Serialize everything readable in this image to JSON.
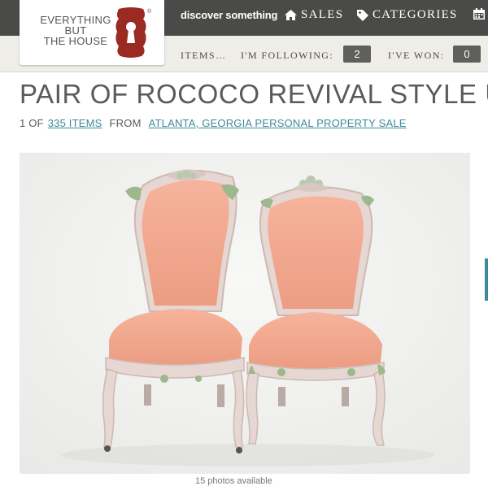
{
  "header": {
    "logo_lines": [
      "EVERYTHING",
      "BUT",
      "THE HOUSE"
    ],
    "logo_reg": "®",
    "discover": "discover something",
    "nav": {
      "sales": "SALES",
      "categories": "CATEGORIES"
    }
  },
  "subnav": {
    "items": "ITEMS…",
    "following_label": "I'M FOLLOWING:",
    "following_count": "2",
    "won_label": "I'VE WON:",
    "won_count": "0"
  },
  "item": {
    "title": "PAIR OF ROCOCO REVIVAL STYLE U",
    "position": "1 OF",
    "count_link": "335 ITEMS",
    "from": "FROM",
    "sale_link": "ATLANTA, GEORGIA PERSONAL PROPERTY SALE",
    "photos_caption": "15 photos available"
  },
  "colors": {
    "topbar": "#4a4a48",
    "subbar": "#efede7",
    "accent_link": "#3d8a9a",
    "logo_red": "#9b2a22",
    "upholstery": "#f2a98f",
    "frame": "#e6d7d2",
    "carving_green": "#9db88c"
  },
  "icons": {
    "sales": "home-icon",
    "categories": "tag-icon",
    "calendar": "calendar-icon",
    "logo": "keyhole-shield-icon"
  }
}
